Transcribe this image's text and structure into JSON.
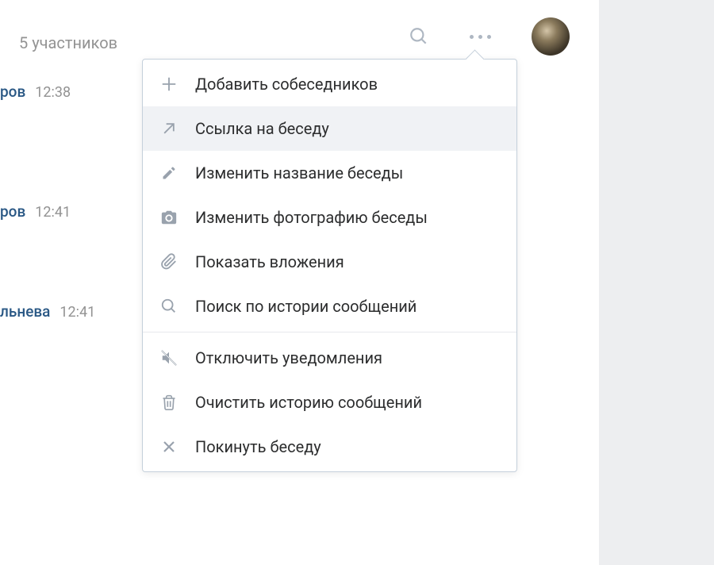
{
  "header": {
    "participants": "5 участников"
  },
  "messages": [
    {
      "name_fragment": "ров",
      "time": "12:38"
    },
    {
      "name_fragment": "ров",
      "time": "12:41"
    },
    {
      "name_fragment": "льнева",
      "time": "12:41"
    }
  ],
  "menu": {
    "add": "Добавить собеседников",
    "link": "Ссылка на беседу",
    "rename": "Изменить название беседы",
    "photo": "Изменить фотографию беседы",
    "attachments": "Показать вложения",
    "search": "Поиск по истории сообщений",
    "mute": "Отключить уведомления",
    "clear": "Очистить историю сообщений",
    "leave": "Покинуть беседу"
  }
}
